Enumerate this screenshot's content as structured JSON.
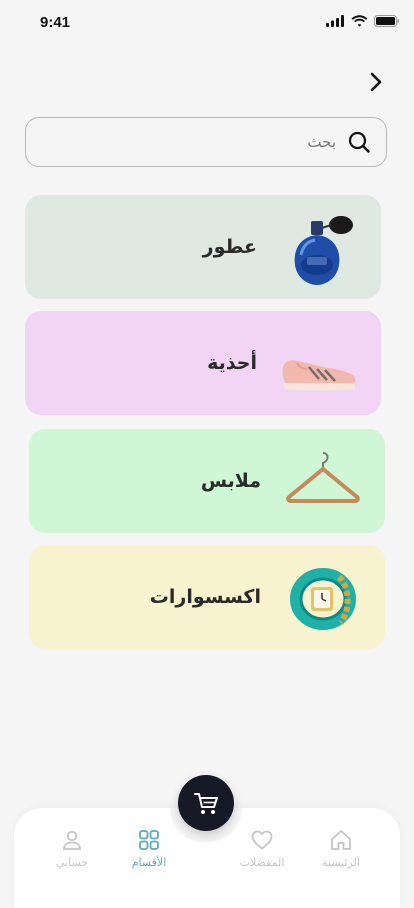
{
  "status_bar": {
    "time": "9:41"
  },
  "search": {
    "placeholder": "بحث"
  },
  "categories": [
    {
      "label": "عطور",
      "background": "#dfe9e2",
      "icon": "perfume-bottle"
    },
    {
      "label": "أحذية",
      "background": "#f2d4f4",
      "icon": "sneaker-shoe"
    },
    {
      "label": "ملابس",
      "background": "#cff6d5",
      "icon": "clothes-hanger"
    },
    {
      "label": "اكسسوارات",
      "background": "#f7f3cf",
      "icon": "wrist-watch"
    }
  ],
  "bottom_nav": {
    "items": [
      {
        "label": "الرئيسية",
        "icon": "home-icon",
        "active": false
      },
      {
        "label": "المفضلات",
        "icon": "heart-icon",
        "active": false
      },
      {
        "label": "الأقسام",
        "icon": "grid-icon",
        "active": true
      },
      {
        "label": "حسابي",
        "icon": "user-icon",
        "active": false
      }
    ],
    "cart_icon": "cart-icon"
  },
  "colors": {
    "accent": "#5aaab7",
    "fab": "#161a26",
    "inactive": "#c4c4c4"
  }
}
